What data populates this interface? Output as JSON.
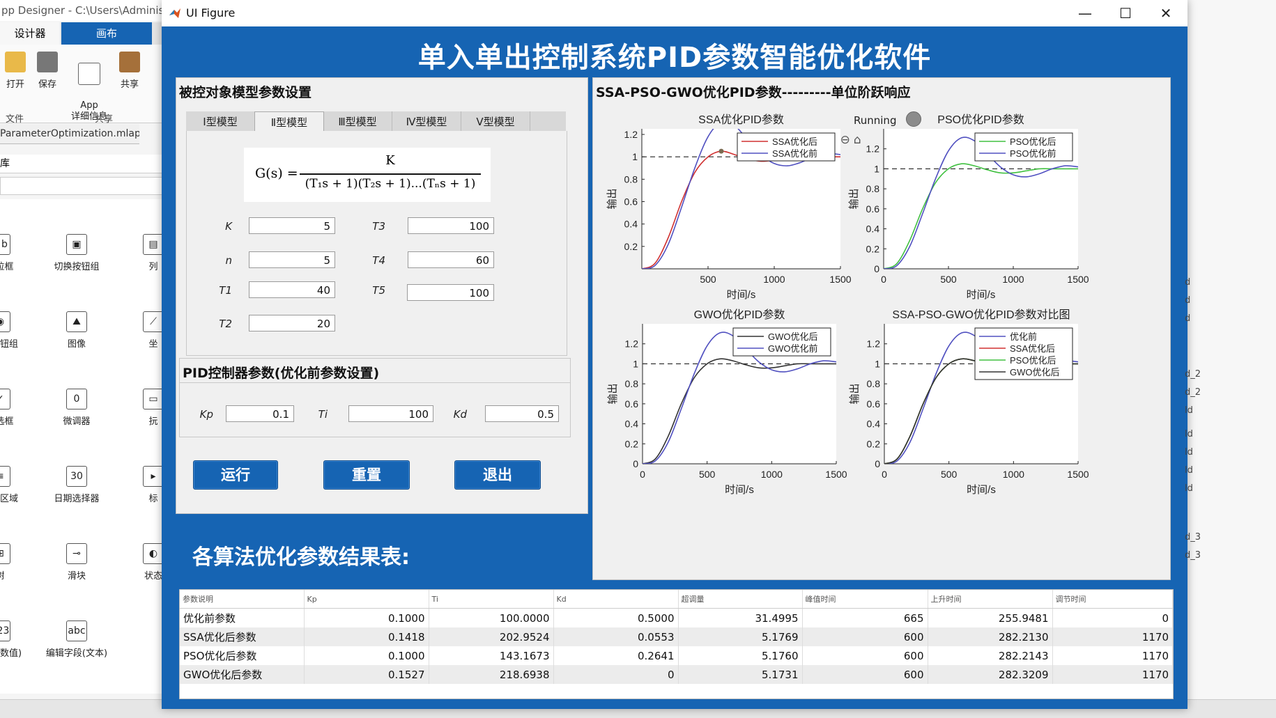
{
  "background_app": {
    "title": "pp Designer - C:\\Users\\Administr",
    "ribbon_tabs": [
      "设计器",
      "画布"
    ],
    "ribbon_buttons": [
      {
        "label": "打开",
        "icon": "folder-icon"
      },
      {
        "label": "保存",
        "icon": "save-icon"
      },
      {
        "label": "App\n详细信息",
        "icon": "details-icon"
      },
      {
        "label": "共享",
        "icon": "share-icon"
      }
    ],
    "ribbon_groups": [
      "文件",
      "共享"
    ],
    "file_tab": "ParameterOptimization.mlapp",
    "file_tab_close": "×",
    "library_label": "库",
    "components": [
      {
        "label": "下拉框",
        "glyph": "a b"
      },
      {
        "label": "切换按钮组",
        "glyph": "▣"
      },
      {
        "label": "列",
        "glyph": "▤"
      },
      {
        "label": "选按钮组",
        "glyph": "◉"
      },
      {
        "label": "图像",
        "glyph": "⛰"
      },
      {
        "label": "坐",
        "glyph": "⟋"
      },
      {
        "label": "复选框",
        "glyph": "✓"
      },
      {
        "label": "微调器",
        "glyph": "0"
      },
      {
        "label": "抏",
        "glyph": "▭"
      },
      {
        "label": "文本区域",
        "glyph": "≡"
      },
      {
        "label": "日期选择器",
        "glyph": "30"
      },
      {
        "label": "标",
        "glyph": "▸"
      },
      {
        "label": "树",
        "glyph": "⊞"
      },
      {
        "label": "滑块",
        "glyph": "⊸"
      },
      {
        "label": "状态",
        "glyph": "◐"
      },
      {
        "label": "字段(数值)",
        "glyph": "123"
      },
      {
        "label": "编辑字段(文本)",
        "glyph": "abc"
      }
    ],
    "right_labels": [
      "d",
      "d",
      "d",
      "d_2",
      "d_2",
      "ld",
      "ld",
      "ld",
      "ld",
      "ld",
      "d_3",
      "d_3"
    ]
  },
  "window": {
    "title": "UI Figure",
    "minimize": "—",
    "maximize": "☐",
    "close": "✕"
  },
  "app": {
    "title": "单入单出控制系统PID参数智能优化软件",
    "model_panel": {
      "title": "被控对象模型参数设置",
      "tabs": [
        "Ⅰ型模型",
        "Ⅱ型模型",
        "Ⅲ型模型",
        "Ⅳ型模型",
        "Ⅴ型模型"
      ],
      "active_tab": 1,
      "formula": {
        "lhs": "G(s) =",
        "numerator": "K",
        "denominator": "(T₁s + 1)(T₂s + 1)...(Tₙs + 1)"
      },
      "params": {
        "K": {
          "label": "K",
          "value": "5"
        },
        "n": {
          "label": "n",
          "value": "5"
        },
        "T1": {
          "label": "T1",
          "value": "40"
        },
        "T2": {
          "label": "T2",
          "value": "20"
        },
        "T3": {
          "label": "T3",
          "value": "100"
        },
        "T4": {
          "label": "T4",
          "value": "60"
        },
        "T5": {
          "label": "T5",
          "value": "100"
        }
      }
    },
    "pid_panel": {
      "title": "PID控制器参数(优化前参数设置)",
      "Kp": {
        "label": "Kp",
        "value": "0.1"
      },
      "Ti": {
        "label": "Ti",
        "value": "100"
      },
      "Kd": {
        "label": "Kd",
        "value": "0.5"
      }
    },
    "buttons": {
      "run": "运行",
      "reset": "重置",
      "exit": "退出"
    },
    "results_title": "各算法优化参数结果表:",
    "table": {
      "headers": [
        "参数说明",
        "Kp",
        "Ti",
        "Kd",
        "超调量",
        "峰值时间",
        "上升时间",
        "调节时间"
      ],
      "rows": [
        [
          "优化前参数",
          "0.1000",
          "100.0000",
          "0.5000",
          "31.4995",
          "665",
          "255.9481",
          "0"
        ],
        [
          "SSA优化后参数",
          "0.1418",
          "202.9524",
          "0.0553",
          "5.1769",
          "600",
          "282.2130",
          "1170"
        ],
        [
          "PSO优化后参数",
          "0.1000",
          "143.1673",
          "0.2641",
          "5.1760",
          "600",
          "282.2143",
          "1170"
        ],
        [
          "GWO优化后参数",
          "0.1527",
          "218.6938",
          "0",
          "5.1731",
          "600",
          "282.3209",
          "1170"
        ]
      ]
    },
    "chart_panel": {
      "title": "SSA-PSO-GWO优化PID参数---------单位阶跃响应",
      "status_label": "Running",
      "lamp_color": "#8c8c8c"
    }
  },
  "chart_data": [
    {
      "type": "line",
      "title": "SSA优化PID参数",
      "xlabel": "时间/s",
      "ylabel": "输出",
      "xlim": [
        0,
        1500
      ],
      "ylim": [
        0,
        1.25
      ],
      "xticks": [
        500,
        1000,
        1500
      ],
      "yticks": [
        0.2,
        0.4,
        0.6,
        0.8,
        1,
        1.2
      ],
      "reference": 1,
      "legend_position": "top-right",
      "series": [
        {
          "name": "SSA优化后",
          "color": "#d03030",
          "x": [
            0,
            100,
            200,
            300,
            400,
            500,
            600,
            700,
            800,
            900,
            1000,
            1100,
            1200,
            1300,
            1400,
            1500
          ],
          "y": [
            0,
            0.05,
            0.28,
            0.6,
            0.86,
            1.0,
            1.05,
            1.02,
            0.98,
            0.96,
            0.97,
            0.99,
            1.0,
            1.0,
            1.0,
            1.0
          ]
        },
        {
          "name": "SSA优化前",
          "color": "#5050c0",
          "x": [
            0,
            100,
            200,
            300,
            400,
            500,
            600,
            700,
            800,
            900,
            1000,
            1100,
            1200,
            1300,
            1400,
            1500
          ],
          "y": [
            0,
            0.03,
            0.22,
            0.55,
            0.9,
            1.18,
            1.31,
            1.28,
            1.15,
            1.02,
            0.94,
            0.92,
            0.95,
            1.0,
            1.03,
            1.02
          ]
        }
      ]
    },
    {
      "type": "line",
      "title": "PSO优化PID参数",
      "xlabel": "时间/s",
      "ylabel": "输出",
      "xlim": [
        0,
        1500
      ],
      "ylim": [
        0,
        1.4
      ],
      "xticks": [
        0,
        500,
        1000,
        1500
      ],
      "yticks": [
        0,
        0.2,
        0.4,
        0.6,
        0.8,
        1,
        1.2
      ],
      "reference": 1,
      "legend_position": "top-right",
      "series": [
        {
          "name": "PSO优化后",
          "color": "#40c040",
          "x": [
            0,
            100,
            200,
            300,
            400,
            500,
            600,
            700,
            800,
            900,
            1000,
            1100,
            1200,
            1300,
            1400,
            1500
          ],
          "y": [
            0,
            0.05,
            0.28,
            0.6,
            0.86,
            1.0,
            1.05,
            1.03,
            0.99,
            0.96,
            0.96,
            0.98,
            1.0,
            1.0,
            1.0,
            1.0
          ]
        },
        {
          "name": "PSO优化前",
          "color": "#5050c0",
          "x": [
            0,
            100,
            200,
            300,
            400,
            500,
            600,
            700,
            800,
            900,
            1000,
            1100,
            1200,
            1300,
            1400,
            1500
          ],
          "y": [
            0,
            0.03,
            0.22,
            0.55,
            0.9,
            1.18,
            1.31,
            1.28,
            1.15,
            1.02,
            0.94,
            0.92,
            0.95,
            1.0,
            1.03,
            1.02
          ]
        }
      ]
    },
    {
      "type": "line",
      "title": "GWO优化PID参数",
      "xlabel": "时间/s",
      "ylabel": "输出",
      "xlim": [
        0,
        1500
      ],
      "ylim": [
        0,
        1.4
      ],
      "xticks": [
        0,
        500,
        1000,
        1500
      ],
      "yticks": [
        0,
        0.2,
        0.4,
        0.6,
        0.8,
        1,
        1.2
      ],
      "reference": 1,
      "legend_position": "top-right",
      "series": [
        {
          "name": "GWO优化后",
          "color": "#333333",
          "x": [
            0,
            100,
            200,
            300,
            400,
            500,
            600,
            700,
            800,
            900,
            1000,
            1100,
            1200,
            1300,
            1400,
            1500
          ],
          "y": [
            0,
            0.05,
            0.28,
            0.6,
            0.86,
            1.0,
            1.05,
            1.03,
            0.99,
            0.96,
            0.96,
            0.98,
            1.0,
            1.0,
            1.0,
            1.0
          ]
        },
        {
          "name": "GWO优化前",
          "color": "#5050c0",
          "x": [
            0,
            100,
            200,
            300,
            400,
            500,
            600,
            700,
            800,
            900,
            1000,
            1100,
            1200,
            1300,
            1400,
            1500
          ],
          "y": [
            0,
            0.03,
            0.22,
            0.55,
            0.9,
            1.18,
            1.31,
            1.28,
            1.15,
            1.02,
            0.94,
            0.92,
            0.95,
            1.0,
            1.03,
            1.02
          ]
        }
      ]
    },
    {
      "type": "line",
      "title": "SSA-PSO-GWO优化PID参数对比图",
      "xlabel": "时间/s",
      "ylabel": "输出",
      "xlim": [
        0,
        1500
      ],
      "ylim": [
        0,
        1.4
      ],
      "xticks": [
        0,
        500,
        1000,
        1500
      ],
      "yticks": [
        0,
        0.2,
        0.4,
        0.6,
        0.8,
        1,
        1.2
      ],
      "reference": 1,
      "legend_position": "top-right",
      "series": [
        {
          "name": "优化前",
          "color": "#5050c0",
          "x": [
            0,
            100,
            200,
            300,
            400,
            500,
            600,
            700,
            800,
            900,
            1000,
            1100,
            1200,
            1300,
            1400,
            1500
          ],
          "y": [
            0,
            0.03,
            0.22,
            0.55,
            0.9,
            1.18,
            1.31,
            1.28,
            1.15,
            1.02,
            0.94,
            0.92,
            0.95,
            1.0,
            1.03,
            1.02
          ]
        },
        {
          "name": "SSA优化后",
          "color": "#d03030",
          "x": [
            0,
            100,
            200,
            300,
            400,
            500,
            600,
            700,
            800,
            900,
            1000,
            1100,
            1200,
            1300,
            1400,
            1500
          ],
          "y": [
            0,
            0.05,
            0.28,
            0.6,
            0.86,
            1.0,
            1.05,
            1.03,
            0.99,
            0.96,
            0.96,
            0.98,
            1.0,
            1.0,
            1.0,
            1.0
          ]
        },
        {
          "name": "PSO优化后",
          "color": "#40c040",
          "x": [
            0,
            100,
            200,
            300,
            400,
            500,
            600,
            700,
            800,
            900,
            1000,
            1100,
            1200,
            1300,
            1400,
            1500
          ],
          "y": [
            0,
            0.05,
            0.28,
            0.6,
            0.86,
            1.0,
            1.05,
            1.03,
            0.99,
            0.96,
            0.96,
            0.98,
            1.0,
            1.0,
            1.0,
            1.0
          ]
        },
        {
          "name": "GWO优化后",
          "color": "#333333",
          "x": [
            0,
            100,
            200,
            300,
            400,
            500,
            600,
            700,
            800,
            900,
            1000,
            1100,
            1200,
            1300,
            1400,
            1500
          ],
          "y": [
            0,
            0.05,
            0.28,
            0.6,
            0.86,
            1.0,
            1.05,
            1.03,
            0.99,
            0.96,
            0.96,
            0.98,
            1.0,
            1.0,
            1.0,
            1.0
          ]
        }
      ]
    }
  ]
}
